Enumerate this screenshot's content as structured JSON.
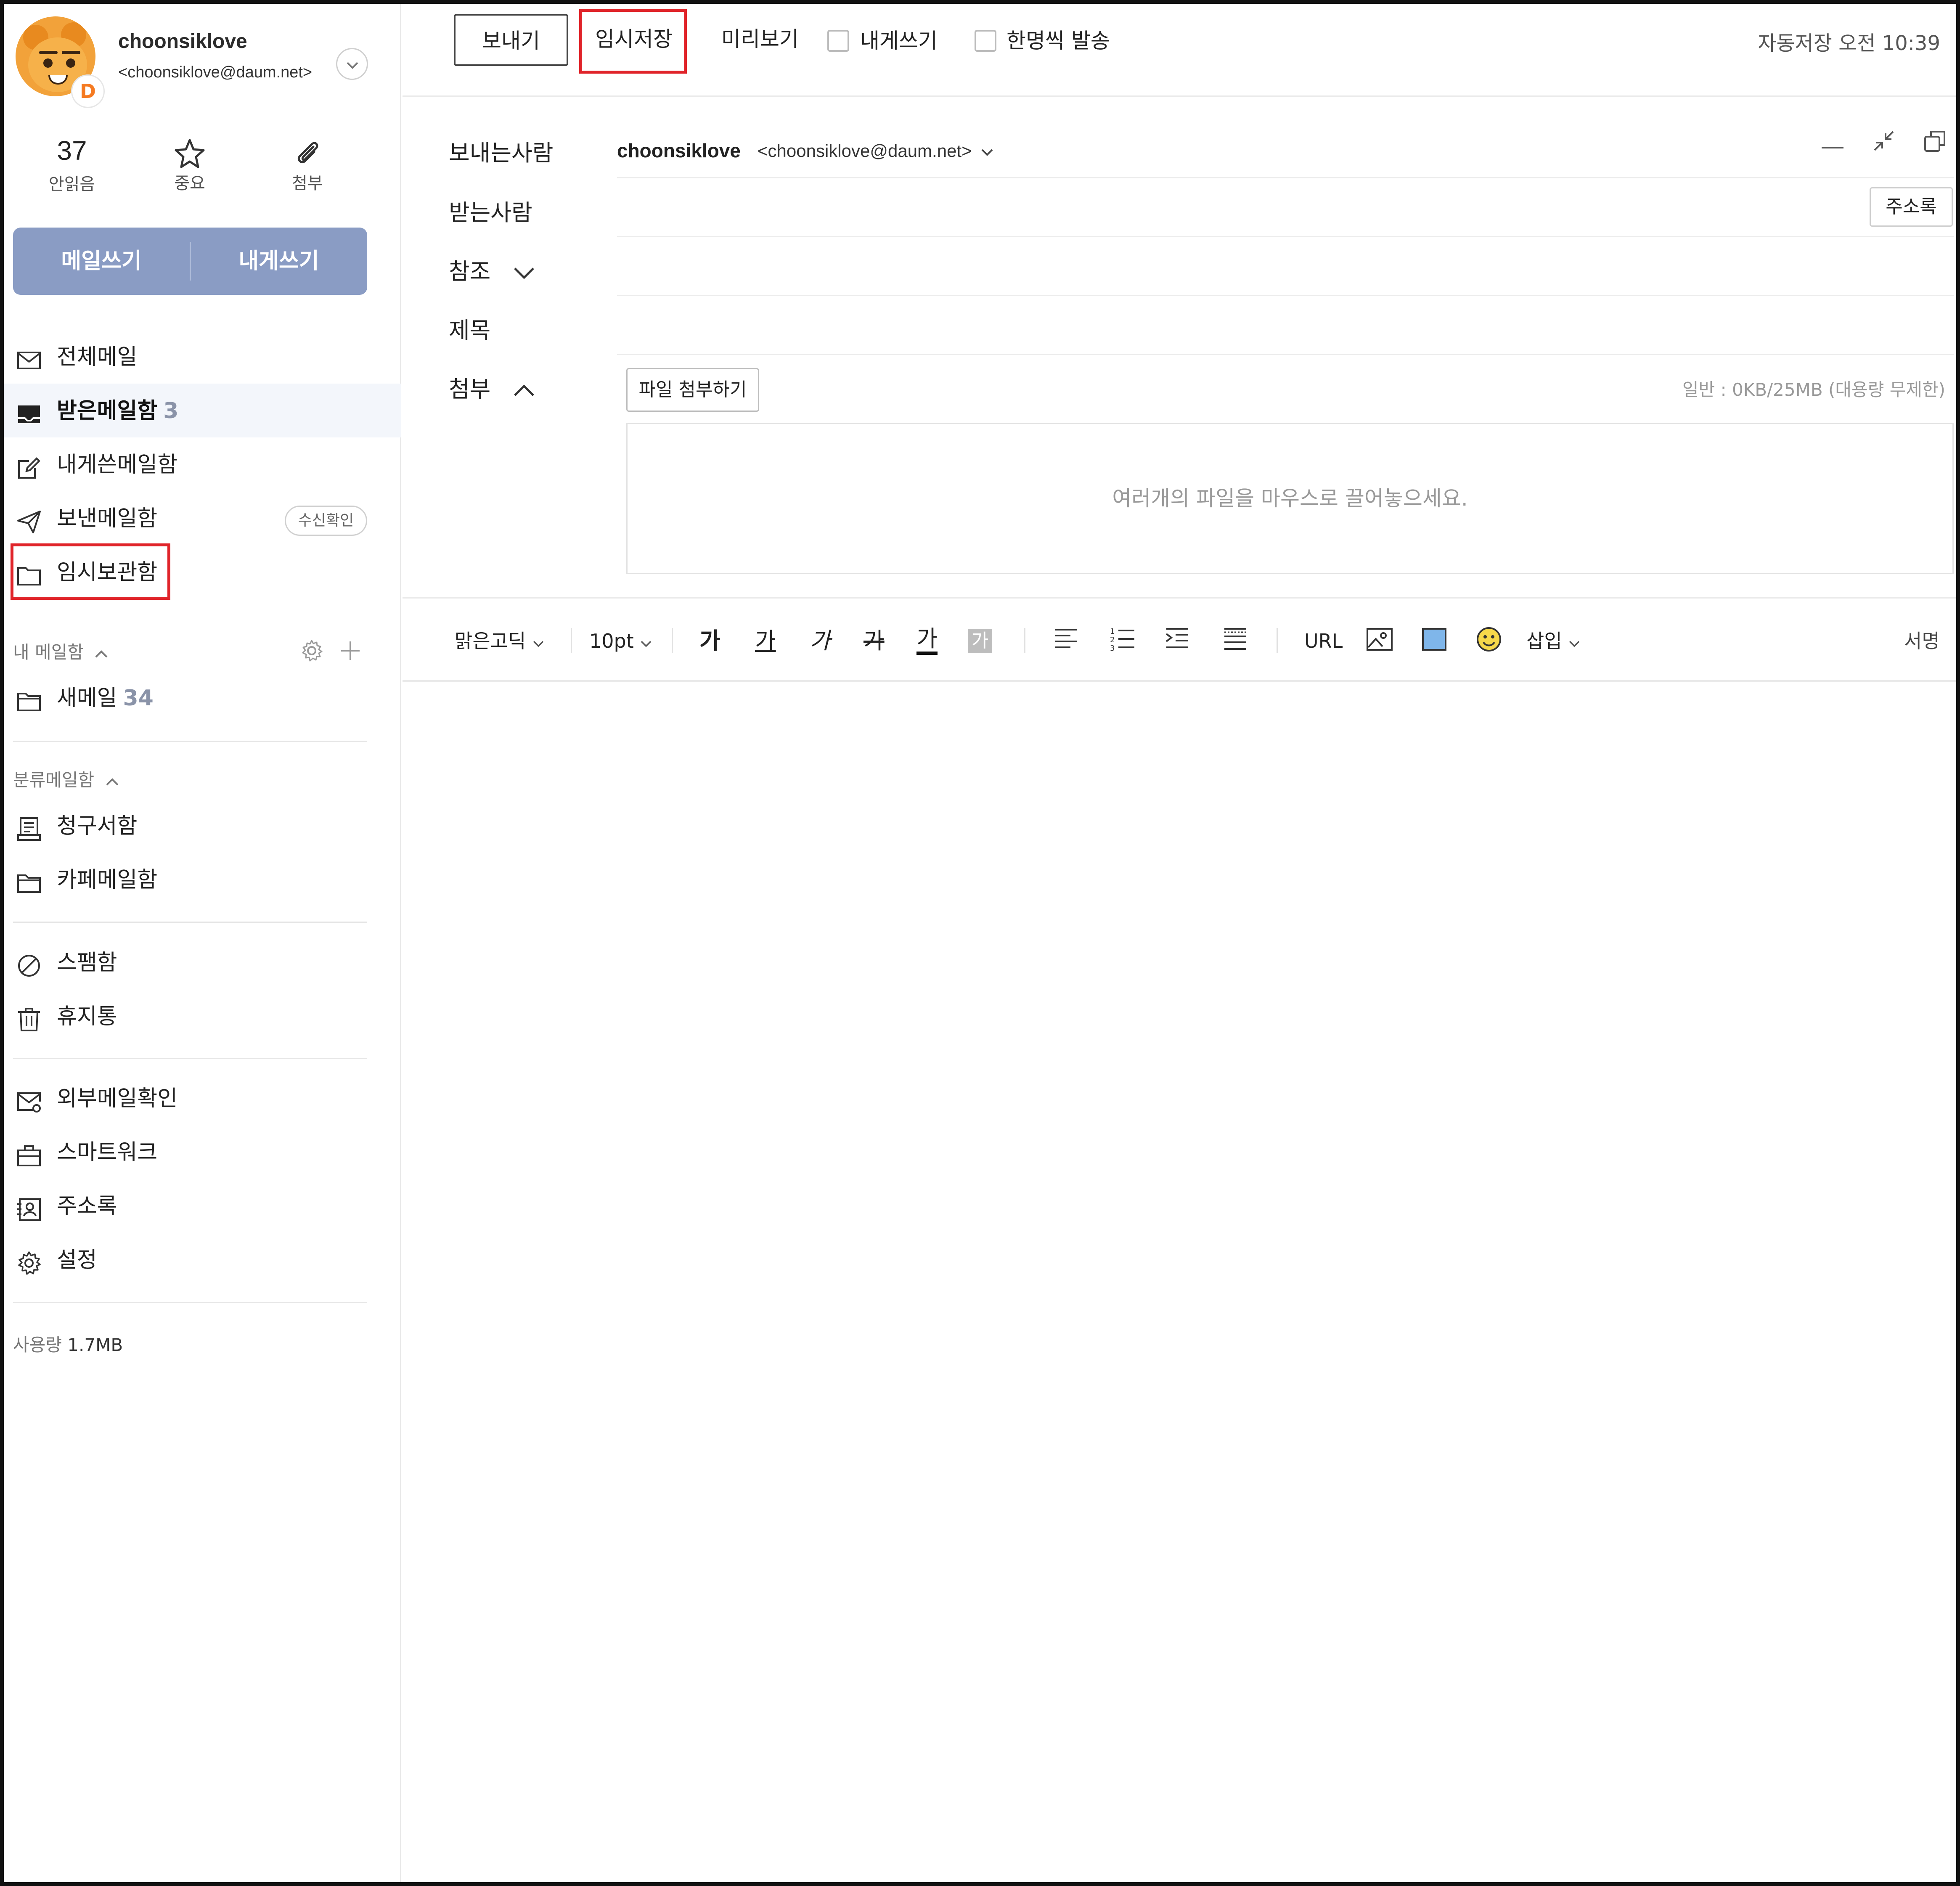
{
  "profile": {
    "name": "choonsiklove",
    "email": "<choonsiklove@daum.net>",
    "badge_letter": "D"
  },
  "stats": {
    "unread_count": "37",
    "unread_label": "안읽음",
    "important_label": "중요",
    "attachment_label": "첨부"
  },
  "compose": {
    "write_mail": "메일쓰기",
    "write_to_me": "내게쓰기"
  },
  "mailboxes": {
    "all": "전체메일",
    "inbox": "받은메일함",
    "inbox_count": "3",
    "to_me": "내게쓴메일함",
    "sent": "보낸메일함",
    "read_receipt": "수신확인",
    "drafts": "임시보관함"
  },
  "my_mailboxes": {
    "title": "내 메일함",
    "items": [
      {
        "label": "새메일",
        "count": "34"
      }
    ]
  },
  "categories": {
    "title": "분류메일함",
    "bills": "청구서함",
    "cafe": "카페메일함"
  },
  "misc": {
    "spam": "스팸함",
    "trash": "휴지통",
    "external": "외부메일확인",
    "smartwork": "스마트워크",
    "contacts": "주소록",
    "settings": "설정"
  },
  "usage": {
    "label": "사용량",
    "value": "1.7MB"
  },
  "toolbar": {
    "send": "보내기",
    "save_draft": "임시저장",
    "preview": "미리보기",
    "to_me_check": "내게쓰기",
    "individual_send": "한명씩 발송",
    "autosave": "자동저장 오전 10:39"
  },
  "compose_form": {
    "sender_label": "보내는사람",
    "sender_name": "choonsiklove",
    "sender_email": "<choonsiklove@daum.net>",
    "recipient_label": "받는사람",
    "address_book_button": "주소록",
    "cc_label": "참조",
    "subject_label": "제목",
    "attach_label": "첨부",
    "attach_button": "파일 첨부하기",
    "attach_info": "일반 : 0KB/25MB (대용량 무제한)",
    "dropzone_text": "여러개의 파일을 마우스로 끌어놓으세요."
  },
  "editor": {
    "font": "맑은고딕",
    "size": "10pt",
    "bold": "가",
    "underline": "가",
    "italic": "가",
    "strike": "가",
    "text_color": "가",
    "bg_color": "가",
    "url": "URL",
    "insert": "삽입",
    "signature": "서명"
  },
  "colors": {
    "compose_bar": "#8a9cc4",
    "highlight_box": "#e0242a",
    "active_bg": "#f3f6fb"
  }
}
